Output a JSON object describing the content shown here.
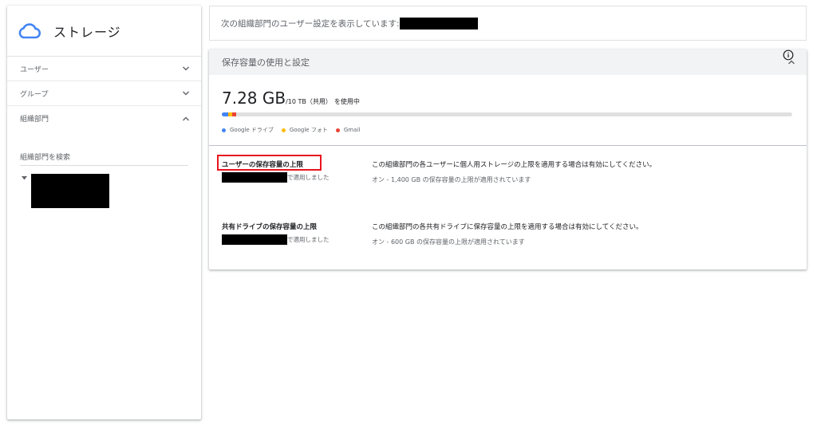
{
  "sidebar": {
    "app_title": "ストレージ",
    "sections": [
      {
        "label": "ユーザー",
        "expanded": false
      },
      {
        "label": "グループ",
        "expanded": false
      },
      {
        "label": "組織部門",
        "expanded": true
      }
    ],
    "search_label": "組織部門を検索"
  },
  "banner": {
    "text": "次の組織部門のユーザー設定を表示しています:"
  },
  "card": {
    "title": "保存容量の使用と設定",
    "usage": {
      "used": "7.28 GB",
      "total": "/10 TB（共用）",
      "suffix": "を使用中"
    },
    "legend": [
      {
        "label": "Google ドライブ",
        "color": "#4285f4"
      },
      {
        "label": "Google フォト",
        "color": "#fbbc04"
      },
      {
        "label": "Gmail",
        "color": "#ea4335"
      }
    ],
    "settings": [
      {
        "name": "ユーザーの保存容量の上限",
        "applied": "で適用しました",
        "description": "この組織部門の各ユーザーに個人用ストレージの上限を適用する場合は有効にしてください。",
        "state": "オン - 1,400 GB の保存容量の上限が適用されています"
      },
      {
        "name": "共有ドライブの保存容量の上限",
        "applied": "で適用しました",
        "description": "この組織部門の各共有ドライブに保存容量の上限を適用する場合は有効にしてください。",
        "state": "オン - 600 GB の保存容量の上限が適用されています"
      }
    ]
  },
  "icons": {
    "app": "cloud-icon",
    "collapse": "chevron-up-icon",
    "expand": "chevron-down-icon",
    "info": "info-icon"
  },
  "colors": {
    "accent": "#4285f4",
    "highlight": "#e8141e"
  }
}
